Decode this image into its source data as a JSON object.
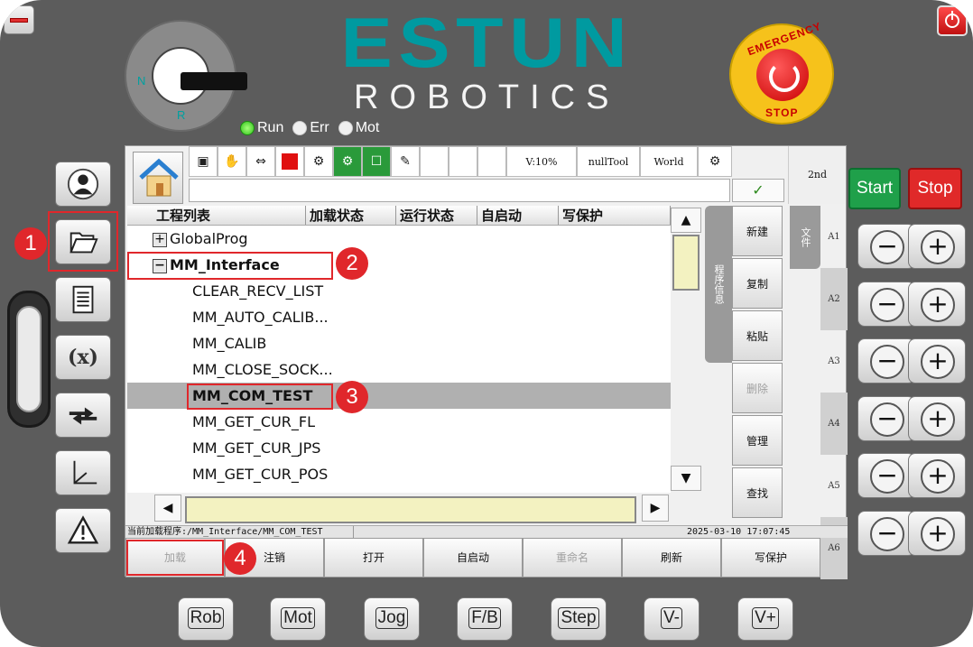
{
  "brand": {
    "logo": "ESTUN",
    "sub": "ROBOTICS"
  },
  "key_switch": {
    "n": "N",
    "r": "R"
  },
  "emergency": {
    "top": "EMERGENCY",
    "bottom": "STOP"
  },
  "indicators": [
    {
      "label": "Run",
      "state": "on"
    },
    {
      "label": "Err",
      "state": "off"
    },
    {
      "label": "Mot",
      "state": "off"
    }
  ],
  "left_buttons": [
    {
      "name": "user-icon"
    },
    {
      "name": "folder-open-icon"
    },
    {
      "name": "document-icon"
    },
    {
      "name": "variable-icon",
      "text": "(x)"
    },
    {
      "name": "transfer-arrows-icon"
    },
    {
      "name": "coordinate-axes-icon"
    },
    {
      "name": "warning-icon"
    }
  ],
  "badges": [
    "1",
    "2",
    "3",
    "4"
  ],
  "toolbar": {
    "velocity": "V:10%",
    "tool": "nullTool",
    "frame": "World",
    "second": "2nd",
    "ok": "✓"
  },
  "list": {
    "columns": [
      "工程列表",
      "加载状态",
      "运行状态",
      "自启动",
      "写保护"
    ],
    "rows": [
      {
        "label": "GlobalProg",
        "tree": "+",
        "level": 0
      },
      {
        "label": "MM_Interface",
        "tree": "−",
        "level": 0,
        "bold": true
      },
      {
        "label": "CLEAR_RECV_LIST",
        "level": 1
      },
      {
        "label": "MM_AUTO_CALIB...",
        "level": 1
      },
      {
        "label": "MM_CALIB",
        "level": 1
      },
      {
        "label": "MM_CLOSE_SOCK...",
        "level": 1
      },
      {
        "label": "MM_COM_TEST",
        "level": 1,
        "selected": true
      },
      {
        "label": "MM_GET_CUR_FL",
        "level": 1
      },
      {
        "label": "MM_GET_CUR_JPS",
        "level": 1
      },
      {
        "label": "MM_GET_CUR_POS",
        "level": 1
      }
    ]
  },
  "side_tabs": {
    "program_info": "程序信息",
    "file": "文件"
  },
  "actions": [
    {
      "label": "新建",
      "enabled": true
    },
    {
      "label": "复制",
      "enabled": true
    },
    {
      "label": "粘贴",
      "enabled": true
    },
    {
      "label": "删除",
      "enabled": false
    },
    {
      "label": "管理",
      "enabled": true
    },
    {
      "label": "查找",
      "enabled": true
    }
  ],
  "axes": [
    "A1",
    "A2",
    "A3",
    "A4",
    "A5",
    "A6"
  ],
  "status": {
    "current_program": "当前加载程序:/MM_Interface/MM_COM_TEST",
    "datetime": "2025-03-10 17:07:45"
  },
  "bottom_actions": [
    {
      "label": "加载",
      "enabled": false
    },
    {
      "label": "注销",
      "enabled": true
    },
    {
      "label": "打开",
      "enabled": true
    },
    {
      "label": "自启动",
      "enabled": true
    },
    {
      "label": "重命名",
      "enabled": false
    },
    {
      "label": "刷新",
      "enabled": true
    },
    {
      "label": "写保护",
      "enabled": true
    }
  ],
  "start_label": "Start",
  "stop_label": "Stop",
  "jog_minus": "−",
  "jog_plus": "+",
  "bottom_keys": [
    "Rob",
    "Mot",
    "Jog",
    "F/B",
    "Step",
    "V-",
    "V+"
  ]
}
